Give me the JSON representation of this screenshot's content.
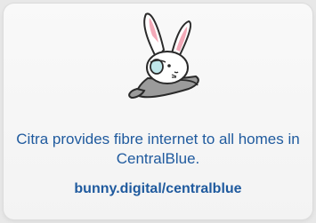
{
  "card": {
    "mascot_icon": "bunny-mascot-icon",
    "message": "Citra provides fibre internet to all homes in CentralBlue.",
    "link_text": "bunny.digital/centralblue"
  },
  "colors": {
    "text": "#1f5a9e",
    "card_background": "#f6f6f6",
    "page_background": "#e8e8e8"
  }
}
